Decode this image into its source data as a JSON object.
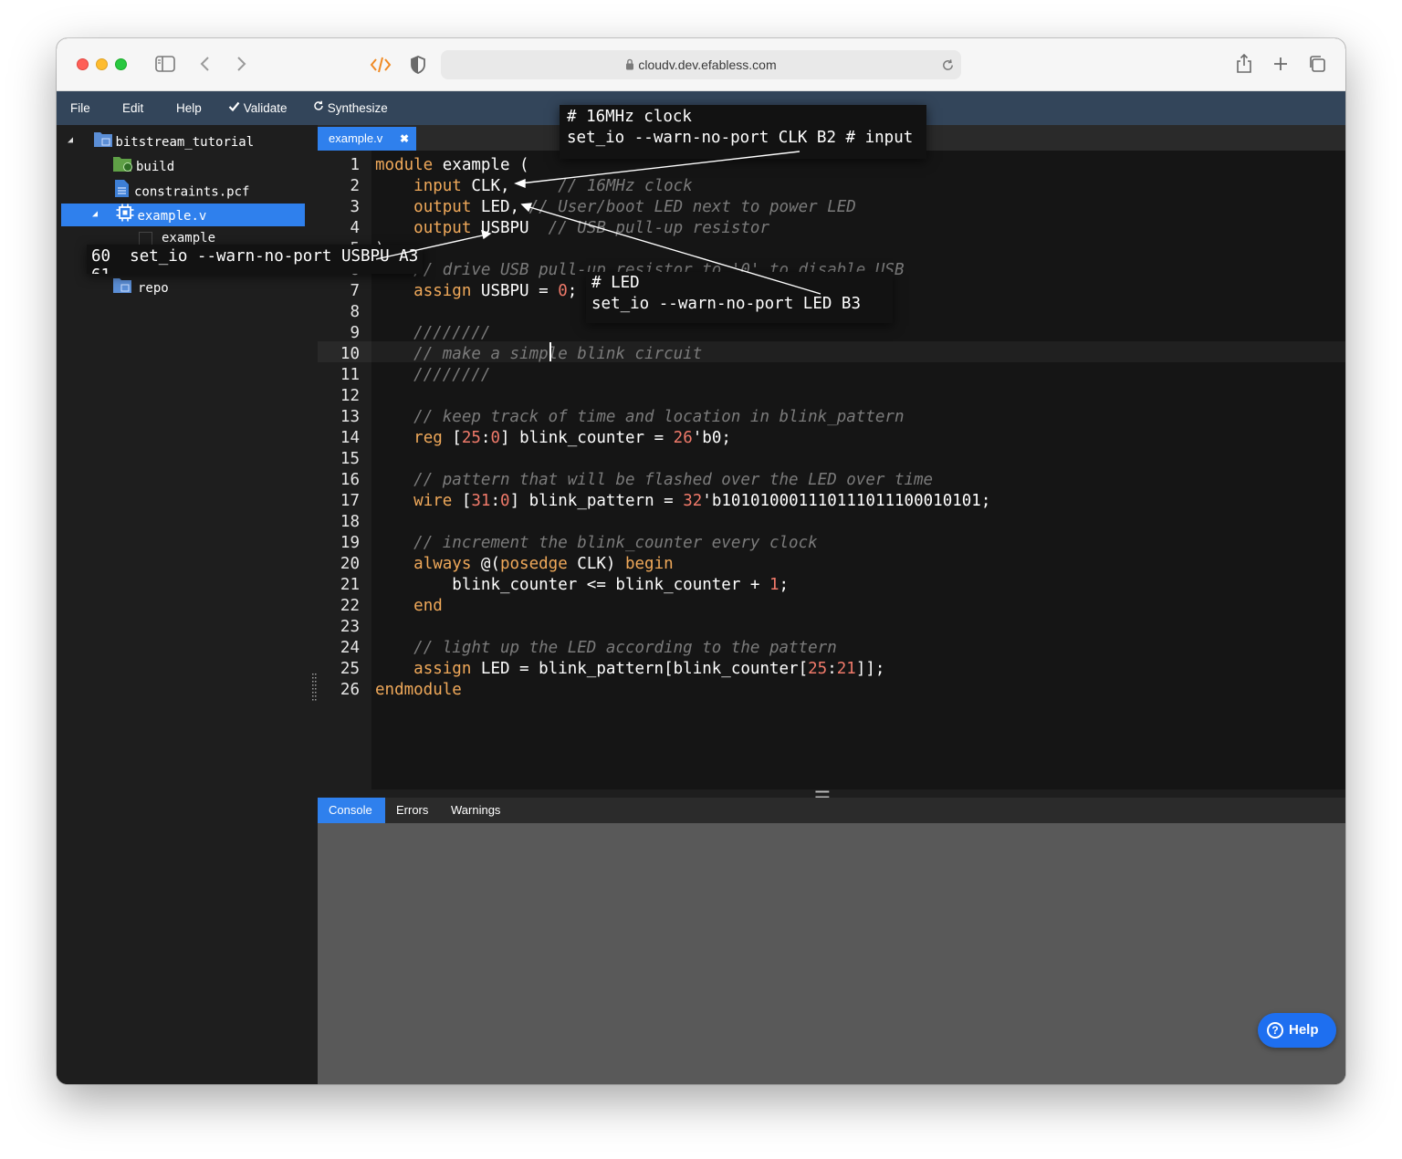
{
  "browser": {
    "url": "cloudv.dev.efabless.com"
  },
  "menu": {
    "file": "File",
    "edit": "Edit",
    "help": "Help",
    "validate": "Validate",
    "synthesize": "Synthesize"
  },
  "tree": {
    "root": "bitstream_tutorial",
    "build": "build",
    "constraints": "constraints.pcf",
    "example_file": "example.v",
    "example_module": "example",
    "repo": "repo"
  },
  "editor": {
    "tab": "example.v",
    "tab_close": "✖",
    "line_numbers": [
      "1",
      "2",
      "3",
      "4",
      "5",
      "6",
      "7",
      "8",
      "9",
      "10",
      "11",
      "12",
      "13",
      "14",
      "15",
      "16",
      "17",
      "18",
      "19",
      "20",
      "21",
      "22",
      "23",
      "24",
      "25",
      "26"
    ],
    "code": {
      "l1_a": "module",
      "l1_b": " example (",
      "l2_a": "input",
      "l2_b": " CLK,",
      "l2_c": "// 16MHz clock",
      "l3_a": "output",
      "l3_b": " LED,",
      "l3_c": "// User/boot LED next to power LED",
      "l4_a": "output",
      "l4_b": " USBPU",
      "l4_c": "// USB pull-up resistor",
      "l5": ");",
      "l6": "// drive USB pull-up resistor to '0' to disable USB",
      "l7_a": "assign",
      "l7_b": " USBPU = ",
      "l7_c": "0",
      "l7_d": ";",
      "l9": "////////",
      "l10": "// make a simple blink circuit",
      "l11": "////////",
      "l13": "// keep track of time and location in blink_pattern",
      "l14_a": "reg",
      "l14_b": " [",
      "l14_c": "25",
      "l14_d": ":",
      "l14_e": "0",
      "l14_f": "] blink_counter = ",
      "l14_g": "26",
      "l14_h": "'b0;",
      "l16": "// pattern that will be flashed over the LED over time",
      "l17_a": "wire",
      "l17_b": " [",
      "l17_c": "31",
      "l17_d": ":",
      "l17_e": "0",
      "l17_f": "] blink_pattern = ",
      "l17_g": "32",
      "l17_h": "'b101010001110111011100010101;",
      "l19": "// increment the blink_counter every clock",
      "l20_a": "always",
      "l20_b": " @(",
      "l20_c": "posedge",
      "l20_d": " CLK) ",
      "l20_e": "begin",
      "l21_a": "blink_counter <= blink_counter + ",
      "l21_b": "1",
      "l21_c": ";",
      "l22": "end",
      "l24": "// light up the LED according to the pattern",
      "l25_a": "assign",
      "l25_b": " LED = blink_pattern[blink_counter[",
      "l25_c": "25",
      "l25_d": ":",
      "l25_e": "21",
      "l25_f": "]];",
      "l26": "endmodule"
    }
  },
  "console": {
    "tabs": [
      "Console",
      "Errors",
      "Warnings"
    ]
  },
  "help_button": "Help",
  "help_icon": "?",
  "annotations": {
    "clk_comment": "# 16MHz clock",
    "clk_line": "set_io --warn-no-port CLK B2 # input",
    "usbpu_line_no": "60",
    "usbpu_line_no_next": "61",
    "usbpu_line": "set_io --warn-no-port USBPU A3",
    "led_comment": "# LED",
    "led_line": "set_io --warn-no-port LED B3"
  },
  "colors": {
    "menubar": "#33455a",
    "accent": "#2f80ed",
    "keyword": "#f0a95a",
    "number": "#f07a6a",
    "comment": "#7b7b7b"
  }
}
